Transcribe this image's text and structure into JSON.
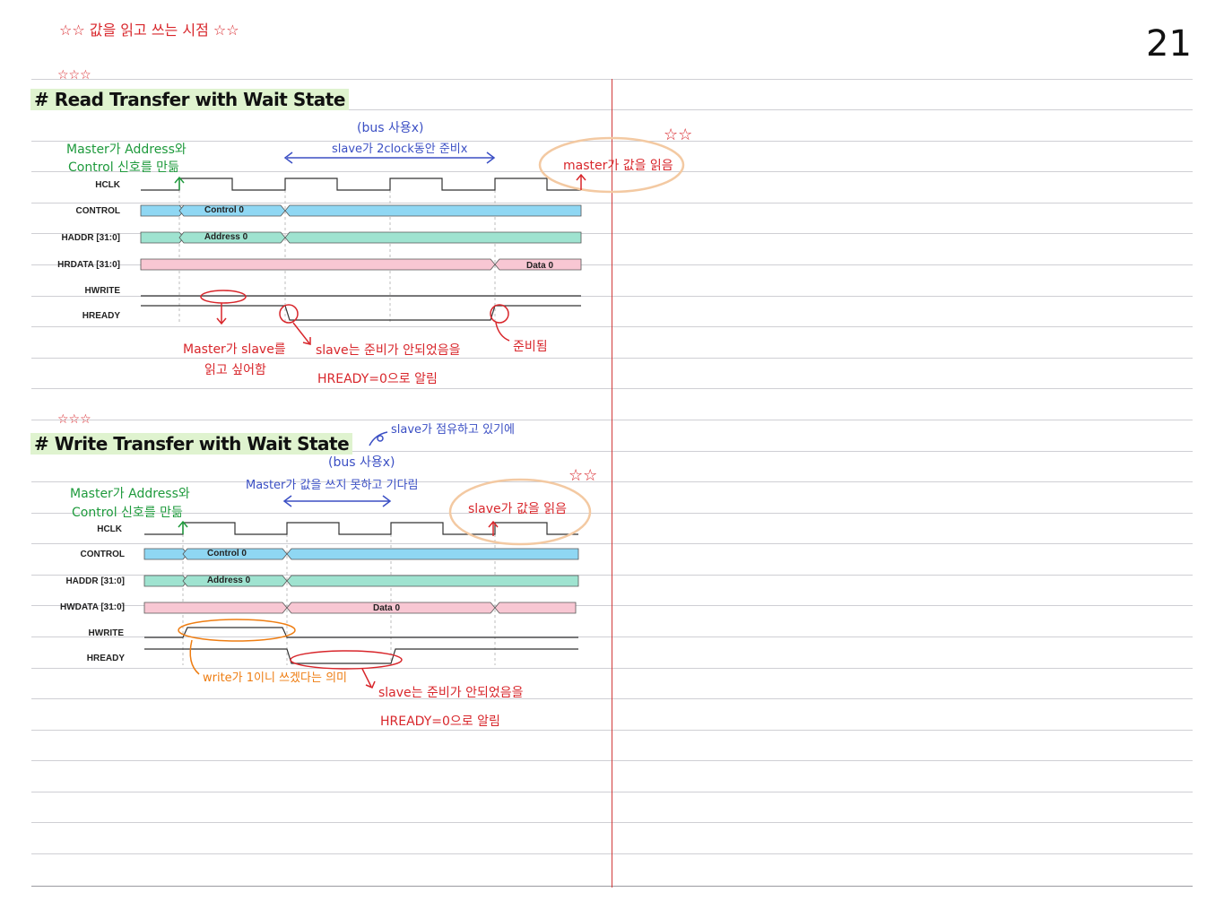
{
  "page": {
    "top_note": "☆☆ 값을 읽고 쓰는 시점 ☆☆",
    "page_number": "21"
  },
  "read_section": {
    "stars": "☆☆☆",
    "title": "# Read Transfer with Wait State",
    "signals": [
      "HCLK",
      "CONTROL",
      "HADDR [31:0]",
      "HRDATA [31:0]",
      "HWRITE",
      "HREADY"
    ],
    "control_label": "Control 0",
    "address_label": "Address 0",
    "data_label": "Data 0",
    "notes": {
      "master_addr_line1": "Master가 Address와",
      "master_addr_line2": "Control 신호를 만듦",
      "bus_unused": "(bus 사용x)",
      "slave_prep": "slave가 2clock동안 준비x",
      "master_reads": "master가 값을 읽음",
      "master_wants_line1": "Master가 slave를",
      "master_wants_line2": "읽고 싶어함",
      "slave_notready_line1": "slave는 준비가 안되었음을",
      "slave_notready_line2": "HREADY=0으로 알림",
      "ready": "준비됨",
      "circle_stars": "☆☆"
    }
  },
  "write_section": {
    "stars": "☆☆☆",
    "title": "# Write Transfer with Wait State",
    "signals": [
      "HCLK",
      "CONTROL",
      "HADDR [31:0]",
      "HWDATA [31:0]",
      "HWRITE",
      "HREADY"
    ],
    "control_label": "Control 0",
    "address_label": "Address 0",
    "data_label": "Data 0",
    "notes": {
      "slave_occupied": "slave가 점유하고 있기에",
      "bus_unused": "(bus 사용x)",
      "master_cannot_write": "Master가 값을 쓰지 못하고 기다림",
      "master_addr_line1": "Master가 Address와",
      "master_addr_line2": "Control 신호를 만듦",
      "slave_reads": "slave가 값을 읽음",
      "write_meaning": "write가 1이니 쓰겠다는 의미",
      "slave_notready_line1": "slave는 준비가 안되었음을",
      "slave_notready_line2": "HREADY=0으로 알림",
      "circle_stars": "☆☆"
    }
  },
  "colors": {
    "control_bus": "#8fd7f3",
    "address_bus": "#9fe3d0",
    "data_bus": "#f8c7d3",
    "ink_red": "#d8262b",
    "ink_green": "#1e9a3c",
    "ink_blue": "#3b4fc4",
    "ink_orange": "#ee7d12",
    "highlight_orange": "#f3c9a2",
    "title_highlight": "#dff3cf"
  }
}
